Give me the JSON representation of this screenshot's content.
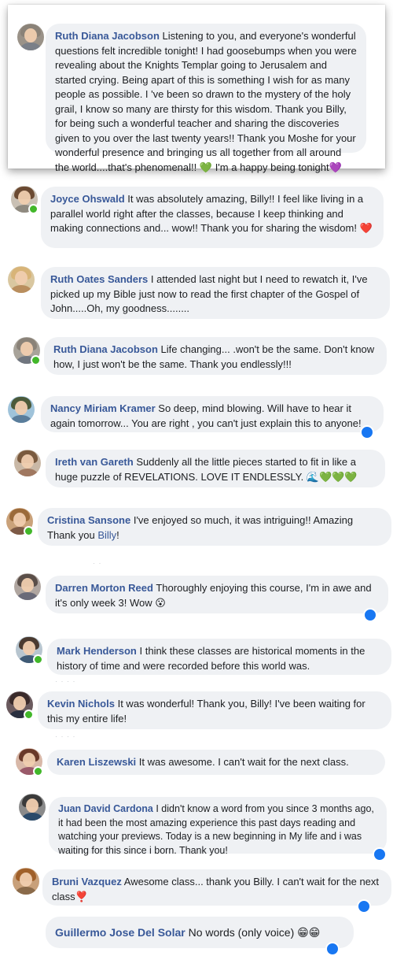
{
  "comments": [
    {
      "name": "Ruth Diana Jacobson",
      "text": "Listening to you, and everyone's wonderful questions felt incredible tonight! I had goosebumps when you were revealing about the Knights Templar going to Jerusalem and started crying. Being apart of this is something I wish for as many people as possible. I 've been so drawn to the mystery of the holy grail, I know so many are thirsty for this wisdom. Thank you Billy, for being such a wonderful teacher and sharing the discoveries given to you over the last twenty years!! Thank you Moshe for your wonderful presence and bringing us all together from all around the world....that's phenomenal!!",
      "emoji_1": "💚",
      "text_2": " I'm a happy being tonight",
      "emoji_2": "💜"
    },
    {
      "name": "Joyce Ohswald",
      "text": "It was absolutely amazing, Billy!! I feel like living in a parallel world right after the classes, because I keep thinking and making connections and... wow!! Thank you for sharing the wisdom!",
      "emoji": "❤️"
    },
    {
      "name": "Ruth Oates Sanders",
      "text": "I attended last night but I need to rewatch it, I've picked up my Bible just now to read the first chapter of the Gospel of John.....Oh, my goodness........"
    },
    {
      "name": "Ruth Diana Jacobson",
      "text": "Life changing... .won't be the same. Don't know how, I just won't be the same. Thank you endlessly!!!"
    },
    {
      "name": "Nancy Miriam Kramer",
      "text": "So deep, mind blowing. Will have to hear it again tomorrow... You are right , you can't just explain this to anyone!"
    },
    {
      "name": "Ireth van Gareth",
      "text": "Suddenly all the little pieces started to fit in like a huge puzzle of REVELATIONS. LOVE IT ENDLESSLY.",
      "emoji": "🌊💚💚💚"
    },
    {
      "name": "Cristina Sansone",
      "text": "I've enjoyed so much, it was intriguing!! Amazing Thank you ",
      "mention": "Billy",
      "text_end": "!"
    },
    {
      "name": "Darren Morton Reed",
      "text": "Thoroughly enjoying this course, I'm in awe and it's only week 3! Wow",
      "emoji": "😮"
    },
    {
      "name": "Mark Henderson",
      "text": "I think these classes are historical moments in the history of time and were recorded before this world was."
    },
    {
      "name": "Kevin Nichols",
      "text": "It was wonderful! Thank you, Billy! I've been waiting for this my entire life!"
    },
    {
      "name": "Karen Liszewski",
      "text": "It was awesome. I can't wait for the next class."
    },
    {
      "name": "Juan David Cardona",
      "text": "I didn't know a word from you since 3 months ago, it had been the most amazing experience this past days reading and watching your previews. Today is a new beginning in My life and i was waiting for this since i born. Thank you!"
    },
    {
      "name": "Bruni Vazquez",
      "text": "Awesome class... thank you Billy. I can't wait for the next class",
      "emoji": "❣️"
    },
    {
      "name": "Guillermo Jose Del Solar",
      "text": "No words (only voice)",
      "emoji": "😁😁"
    }
  ],
  "colors": {
    "name": "#385898",
    "bubble": "#eff1f4",
    "online": "#42b72a",
    "reaction": "#1877f2"
  }
}
